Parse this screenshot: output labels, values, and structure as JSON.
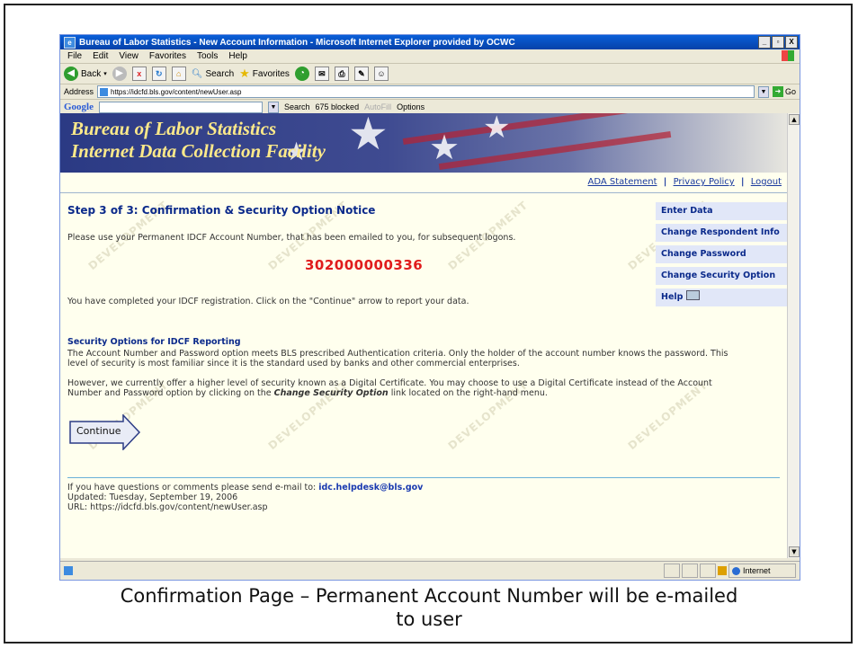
{
  "window": {
    "title": "Bureau of Labor Statistics - New Account Information - Microsoft Internet Explorer provided by OCWC",
    "buttons": [
      "_",
      "▫",
      "X"
    ]
  },
  "menu": [
    "File",
    "Edit",
    "View",
    "Favorites",
    "Tools",
    "Help"
  ],
  "toolbar": {
    "back": "Back",
    "search": "Search",
    "favorites": "Favorites"
  },
  "address": {
    "label": "Address",
    "url": "https://idcfd.bls.gov/content/newUser.asp",
    "go": "Go"
  },
  "googlebar": {
    "logo": "Google",
    "search": "Search",
    "blocked": "675 blocked",
    "autofill": "AutoFill",
    "options": "Options"
  },
  "banner": {
    "line1": "Bureau of Labor Statistics",
    "line2": "Internet Data Collection Facility"
  },
  "toplinks": [
    "ADA Statement",
    "Privacy Policy",
    "Logout"
  ],
  "page": {
    "step_title": "Step 3 of 3: Confirmation & Security Option Notice",
    "intro": "Please use your Permanent IDCF Account Number, that has been emailed to you, for subsequent logons.",
    "account_number": "302000000336",
    "completed": "You have completed your IDCF registration. Click on the \"Continue\" arrow to report your data.",
    "security_title": "Security Options for IDCF Reporting",
    "security_p1_line1": "The Account Number and Password option meets BLS prescribed Authentication criteria. Only the holder of the account number knows the password. This",
    "security_p1_line2": "level of security is most familiar since it is the standard used by banks and other commercial enterprises.",
    "security_p2_line1": "However, we currently offer a higher level of security known as a Digital Certificate. You may choose to use a Digital Certificate instead of the Account",
    "security_p2_line2_pre": "Number and Password option by clicking on the ",
    "security_p2_link": "Change Security Option",
    "security_p2_line2_post": " link located on the right-hand menu.",
    "continue_label": "Continue"
  },
  "rightmenu": [
    "Enter Data",
    "Change Respondent Info",
    "Change Password",
    "Change Security Option",
    "Help"
  ],
  "footer": {
    "contact_pre": "If you have questions or comments please send e-mail to: ",
    "email": "idc.helpdesk@bls.gov",
    "updated": "Updated: Tuesday, September 19, 2006",
    "url": "URL: https://idcfd.bls.gov/content/newUser.asp"
  },
  "statusbar": {
    "zone": "Internet"
  },
  "watermark_text": "DEVELOPMENT",
  "caption": {
    "line1": "Confirmation Page – Permanent Account Number will be e-mailed",
    "line2": "to user"
  },
  "colors": {
    "account_number": "#e01c1c",
    "heading_blue": "#0b2a8b",
    "page_bg": "#ffffee",
    "menu_bg": "#e1e7f8"
  }
}
